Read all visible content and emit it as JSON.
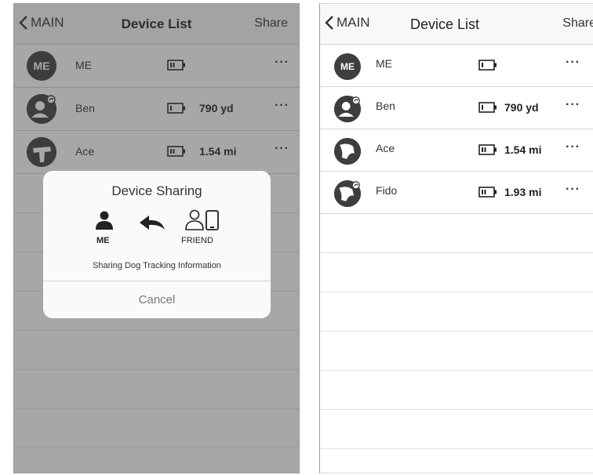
{
  "nav": {
    "back_label": "MAIN",
    "title": "Device List",
    "share_label": "Share"
  },
  "left_screen": {
    "devices": [
      {
        "name": "ME",
        "avatar_text": "ME",
        "distance": "",
        "battery_icon": "battery-low-icon"
      },
      {
        "name": "Ben",
        "avatar_text": "",
        "distance": "790 yd",
        "battery_icon": "battery-low-icon"
      },
      {
        "name": "Ace",
        "avatar_text": "",
        "distance": "1.54 mi",
        "battery_icon": "battery-medium-icon"
      }
    ],
    "more_label": "···"
  },
  "dialog": {
    "title": "Device Sharing",
    "me_label": "ME",
    "friend_label": "FRIEND",
    "subtitle": "Sharing Dog Tracking Information",
    "cancel_label": "Cancel"
  },
  "right_screen": {
    "devices": [
      {
        "name": "ME",
        "avatar_text": "ME",
        "distance": "",
        "battery_icon": "battery-low-icon"
      },
      {
        "name": "Ben",
        "avatar_text": "",
        "distance": "790 yd",
        "battery_icon": "battery-low-icon"
      },
      {
        "name": "Ace",
        "avatar_text": "",
        "distance": "1.54 mi",
        "battery_icon": "battery-medium-icon"
      },
      {
        "name": "Fido",
        "avatar_text": "",
        "distance": "1.93 mi",
        "battery_icon": "battery-medium-icon"
      }
    ],
    "more_label": "···"
  },
  "colors": {
    "avatar": "#3e3e3e",
    "overlay": "#5a5a5a",
    "dialog_bg": "#fafafa",
    "separator": "#d6d6d6"
  }
}
